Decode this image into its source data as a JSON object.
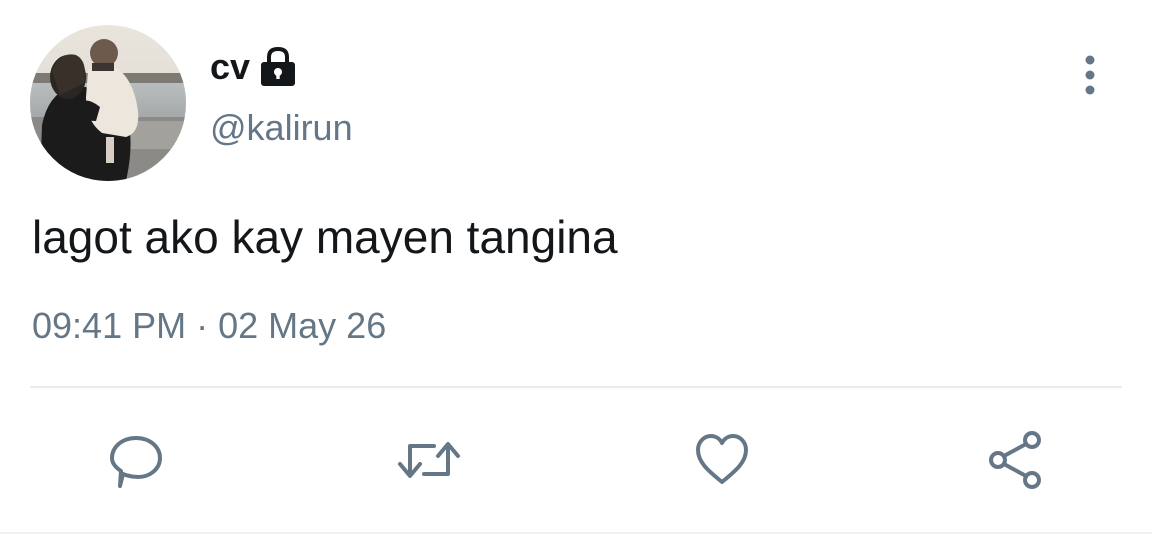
{
  "user": {
    "display_name": "cv",
    "handle": "@kalirun",
    "protected_icon": "lock-icon",
    "avatar": "profile-photo"
  },
  "tweet": {
    "text": "lagot ako kay mayen tangina",
    "time": "09:41 PM",
    "separator": "·",
    "date": "02 May 26"
  },
  "menu_icon": "more-vertical-icon",
  "actions": [
    {
      "name": "reply",
      "icon": "comment-bubble-icon"
    },
    {
      "name": "retweet",
      "icon": "retweet-icon"
    },
    {
      "name": "like",
      "icon": "heart-icon"
    },
    {
      "name": "share",
      "icon": "share-icon"
    }
  ],
  "colors": {
    "text_primary": "#14171a",
    "text_secondary": "#657786",
    "icon": "#657786",
    "divider": "#e6ecf0"
  }
}
